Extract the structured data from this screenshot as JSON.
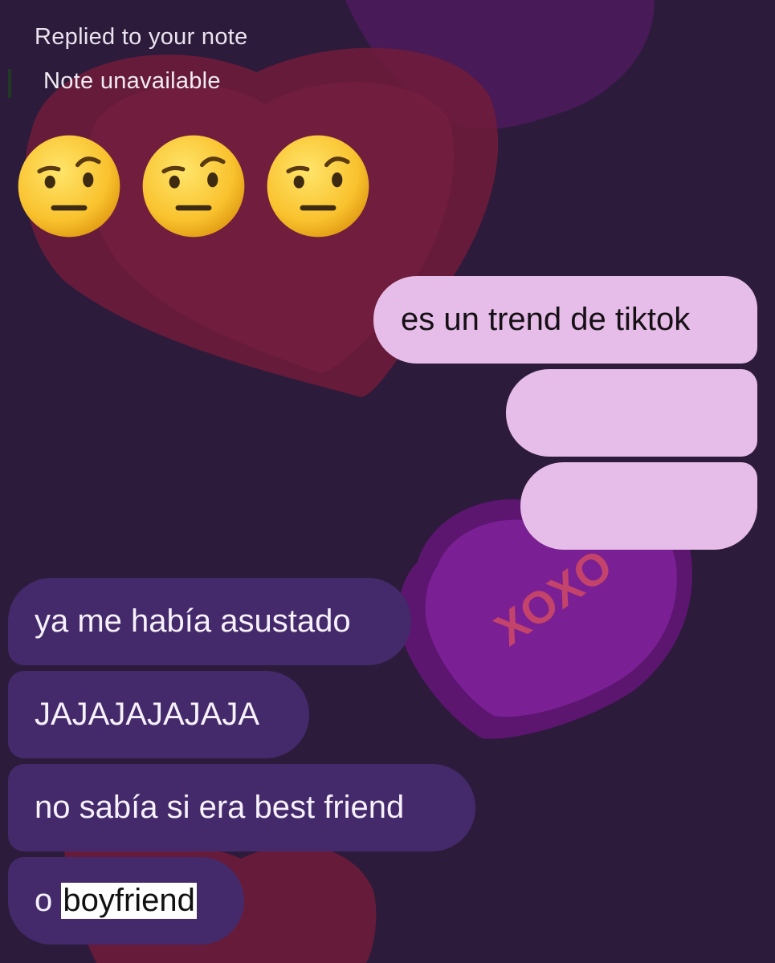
{
  "reply": {
    "label": "Replied to your note",
    "quote": "Note unavailable"
  },
  "emoji": {
    "name": "face-with-raised-eyebrow-icon",
    "count": 3
  },
  "outgoing": [
    {
      "text": "es un trend de tiktok"
    },
    {
      "text": ""
    },
    {
      "text": ""
    }
  ],
  "incoming": [
    {
      "text": "ya me había asustado"
    },
    {
      "text": "JAJAJAJAJAJA"
    },
    {
      "text": "no sabía si era best friend"
    },
    {
      "prefix": "o ",
      "highlight": "boyfriend"
    }
  ],
  "background": {
    "candy_text": "XOXO"
  },
  "colors": {
    "background": "#2c1b3a",
    "outgoing_bubble": "#e6bde8",
    "incoming_bubble": "#442a6b",
    "heart_red": "#741d3c",
    "heart_purple": "#6f1f82"
  }
}
